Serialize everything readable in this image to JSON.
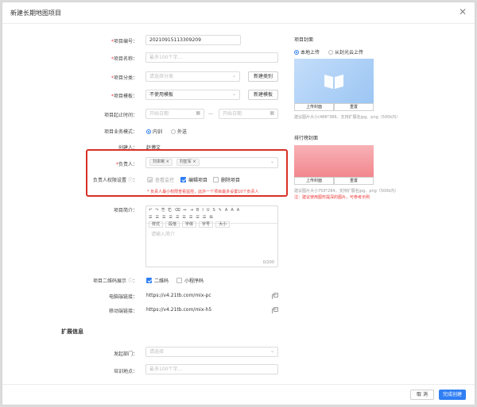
{
  "dialog": {
    "title": "新建长期地图项目"
  },
  "form": {
    "project_no_label": "项目编号：",
    "project_no_value": "20210915113309209",
    "project_name_label": "项目名称：",
    "project_name_placeholder": "最多100个字...",
    "category_label": "项目分类：",
    "category_placeholder": "请选择分类",
    "new_category_btn": "新建类别",
    "template_label": "项目模板：",
    "template_value": "不使用模板",
    "new_template_btn": "新建模板",
    "start_end_label": "项目起止时间：",
    "start_date_placeholder": "开始日期",
    "end_date_placeholder": "开始日期",
    "date_sep": "—",
    "mode_label": "项目业务模式：",
    "mode_internal": "内训",
    "mode_external": "外送",
    "creator_label": "创建人：",
    "creator_value": "赵博文",
    "owner_label": "负责人：",
    "owner_tag_1": "刘本晰",
    "owner_tag_2": "刘亚军",
    "perm_label": "负责人权限设置",
    "perm_view": "查看监控",
    "perm_edit": "编辑项目",
    "perm_delete": "删除项目",
    "perm_warning": "* 负责人最小权限查看监控，此外一个项目最多设置10个负责人",
    "intro_label": "项目简介：",
    "intro_placeholder": "请输入简介",
    "intro_counter": "0/200",
    "qr_label": "项目二维码展示",
    "qr_opt_1": "二维码",
    "qr_opt_2": "小程序码",
    "pc_link_label": "电脑端链接：",
    "pc_link_value": "https://v4.21tb.com/mix-pc",
    "mobile_link_label": "移动端链接：",
    "mobile_link_value": "https://v4.21tb.com/mix-h5"
  },
  "toolbar": {
    "row1": [
      "↶",
      "↷",
      "⎘",
      "⎗",
      "⌫",
      "↔",
      "⇥",
      "B",
      "I",
      "U",
      "S",
      "✎",
      "A",
      "A",
      "A"
    ],
    "row2": [
      "☰",
      "☰",
      "☰",
      "☰",
      "☰",
      "☰",
      "☰",
      "☰",
      "☰",
      "⊞"
    ],
    "row3": [
      "样式",
      "段落",
      "字体",
      "字号",
      "大小"
    ]
  },
  "cover": {
    "title": "项目封面",
    "upload_local": "本地上传",
    "upload_gallery": "从封光云上传",
    "upload_btn": "上传封面",
    "reset_btn": "重置",
    "hint": "建议图片大小(486*386，支持扩展名jpg、png（500k内）"
  },
  "rank_cover": {
    "title": "排行榜封面",
    "upload_btn": "上传封面",
    "reset_btn": "重置",
    "hint": "建议图片大小750*284，支持扩展名jpg、png（500k内）",
    "note": "注：建议使用图形提深的图片，可参考示例"
  },
  "extend": {
    "section_title": "扩展信息",
    "dept_label": "发起部门：",
    "dept_placeholder": "请选择",
    "location_label": "培训地点：",
    "location_placeholder": "最多100个字..."
  },
  "footer": {
    "cancel": "取 消",
    "submit": "完成创建"
  },
  "colors": {
    "accent": "#2f7ef4",
    "warning": "#d93025",
    "cover_blue": "#a8cdf6",
    "cover_red": "#f49aa0"
  }
}
